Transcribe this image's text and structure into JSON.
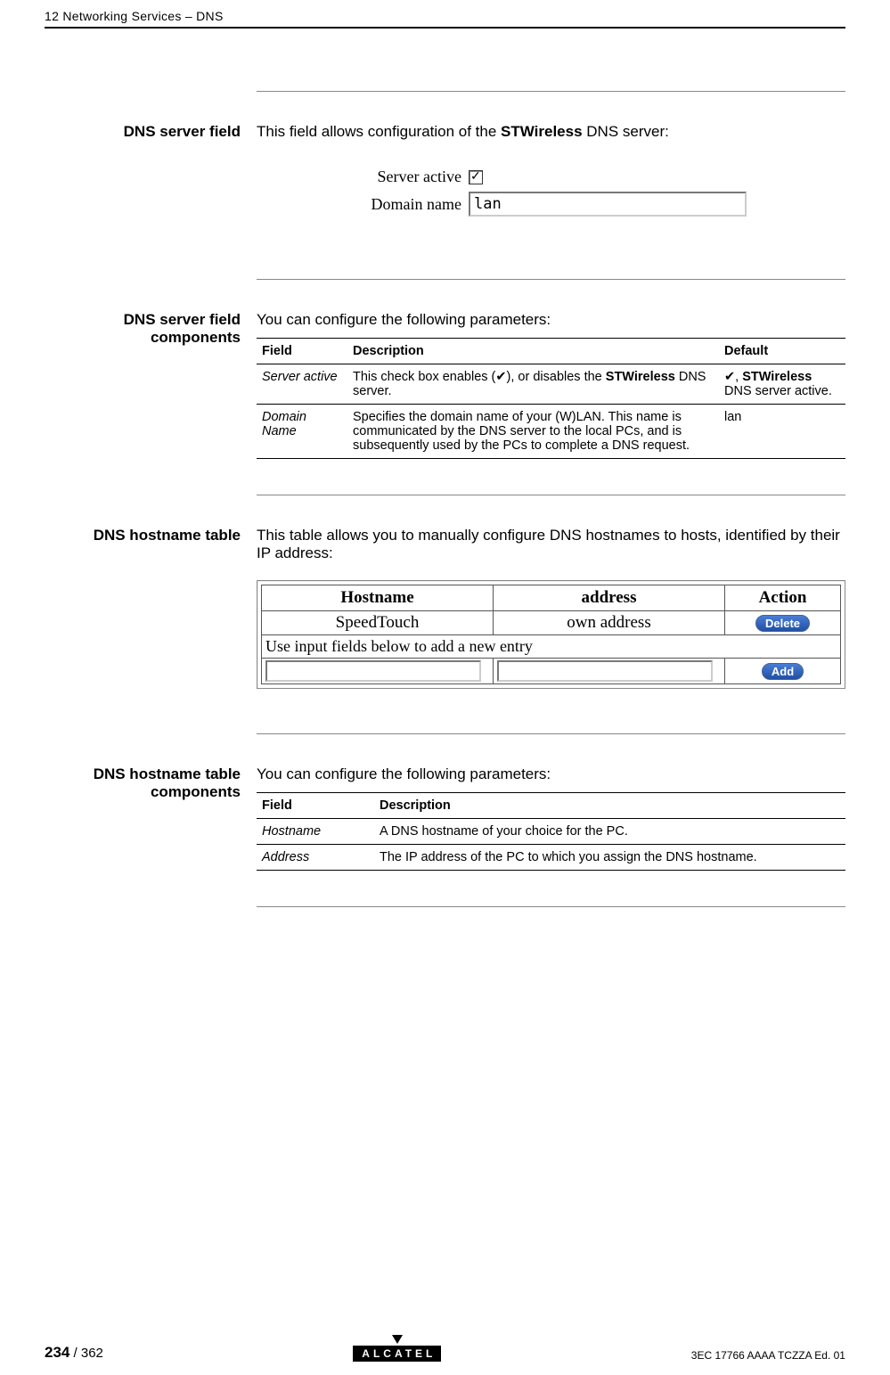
{
  "header": "12 Networking Services – DNS",
  "sections": {
    "serverField": {
      "label": "DNS server field",
      "intro_pre": "This field allows configuration of the ",
      "intro_bold": "STWireless",
      "intro_post": " DNS server:",
      "form": {
        "serverActiveLabel": "Server active",
        "domainNameLabel": "Domain name",
        "domainNameValue": "lan"
      }
    },
    "serverFieldComponents": {
      "label": "DNS server field components",
      "intro": "You can configure the following parameters:",
      "headers": {
        "field": "Field",
        "desc": "Description",
        "def": "Default"
      },
      "rows": [
        {
          "field": "Server active",
          "desc_pre": "This check box enables (",
          "desc_mid": "), or disables the ",
          "desc_bold": "STWireless",
          "desc_post": " DNS server.",
          "def_pre": ", ",
          "def_bold": "STWireless",
          "def_post": " DNS server active."
        },
        {
          "field": "Domain Name",
          "desc": "Specifies the domain name of your (W)LAN. This name is communicated by the DNS server to the local PCs, and is subsequently used by the PCs to complete a DNS request.",
          "def": "lan"
        }
      ]
    },
    "hostnameTable": {
      "label": "DNS hostname table",
      "intro": "This table allows you to manually configure DNS hostnames to hosts, identified by their IP address:",
      "headers": {
        "hostname": "Hostname",
        "address": "address",
        "action": "Action"
      },
      "row": {
        "hostname": "SpeedTouch",
        "address": "own address",
        "action": "Delete"
      },
      "instruction": "Use input fields below to add a new entry",
      "addButton": "Add"
    },
    "hostnameTableComponents": {
      "label": "DNS hostname table components",
      "intro": "You can configure the following parameters:",
      "headers": {
        "field": "Field",
        "desc": "Description"
      },
      "rows": [
        {
          "field": "Hostname",
          "desc": "A DNS hostname of your choice for the PC."
        },
        {
          "field": "Address",
          "desc": "The IP address of the PC to which you assign the DNS hostname."
        }
      ]
    }
  },
  "footer": {
    "pageBold": "234",
    "pageTotal": " / 362",
    "logo": "ALCATEL",
    "docRef": "3EC 17766 AAAA TCZZA Ed. 01"
  },
  "checkmark": "✔"
}
